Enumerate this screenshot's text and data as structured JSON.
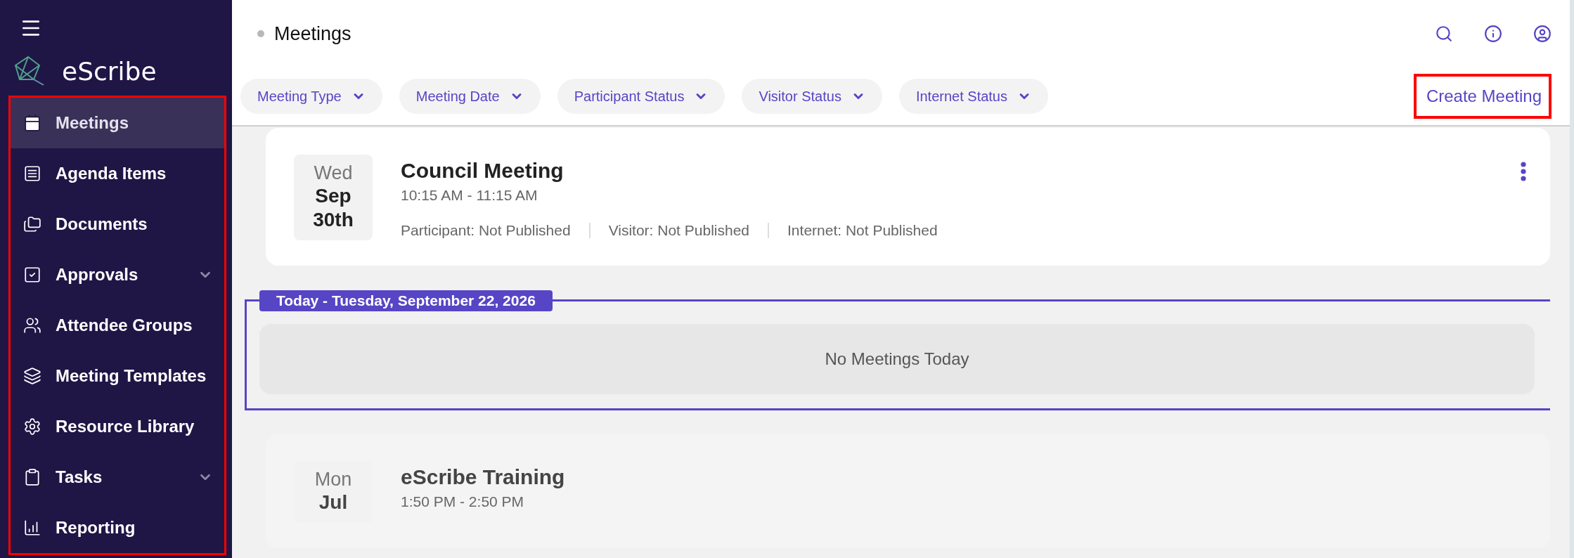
{
  "sidebar": {
    "brand": "eScribe",
    "highlighted": true,
    "items": [
      {
        "label": "Meetings",
        "selected": true,
        "expandable": false
      },
      {
        "label": "Agenda Items",
        "selected": false,
        "expandable": false
      },
      {
        "label": "Documents",
        "selected": false,
        "expandable": false
      },
      {
        "label": "Approvals",
        "selected": false,
        "expandable": true
      },
      {
        "label": "Attendee Groups",
        "selected": false,
        "expandable": false
      },
      {
        "label": "Meeting Templates",
        "selected": false,
        "expandable": false
      },
      {
        "label": "Resource Library",
        "selected": false,
        "expandable": false
      },
      {
        "label": "Tasks",
        "selected": false,
        "expandable": true
      },
      {
        "label": "Reporting",
        "selected": false,
        "expandable": false
      }
    ]
  },
  "header": {
    "title": "Meetings"
  },
  "filters": [
    "Meeting Type",
    "Meeting Date",
    "Participant Status",
    "Visitor Status",
    "Internet Status"
  ],
  "create_button": {
    "label": "Create Meeting",
    "highlighted": true
  },
  "list": [
    {
      "kind": "meeting",
      "dimmed": false,
      "weekday": "Wed",
      "month": "Sep",
      "day": "30th",
      "title": "Council Meeting",
      "time": "10:15 AM - 11:15 AM",
      "statuses": [
        "Participant: Not Published",
        "Visitor: Not Published",
        "Internet: Not Published"
      ]
    },
    {
      "kind": "day_group",
      "label": "Today - Tuesday, September 22, 2026",
      "empty_text": "No Meetings Today"
    },
    {
      "kind": "meeting",
      "dimmed": true,
      "weekday": "Mon",
      "month": "Jul",
      "title": "eScribe Training",
      "time": "1:50 PM - 2:50 PM"
    }
  ]
}
